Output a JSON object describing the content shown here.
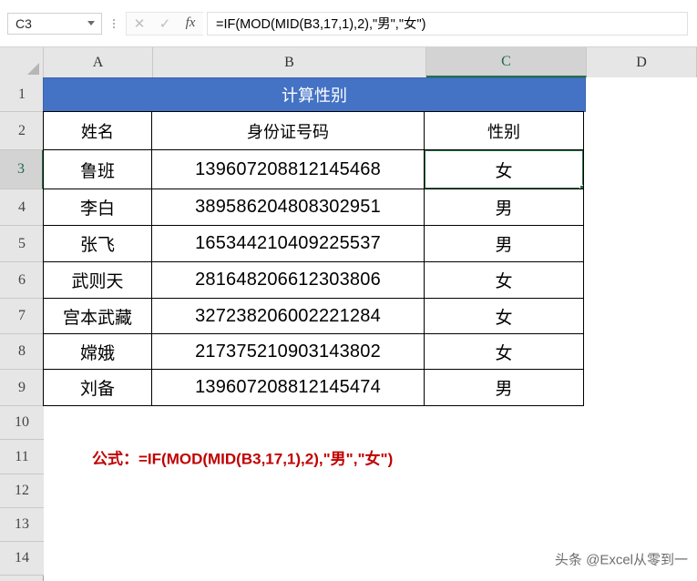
{
  "formula_bar": {
    "name_box_value": "C3",
    "name_box_caret_icon": "chevron-down-icon",
    "cancel_icon": "✕",
    "confirm_icon": "✓",
    "function_icon": "fx",
    "formula_value": "=IF(MOD(MID(B3,17,1),2),\"男\",\"女\")"
  },
  "grid": {
    "columns": [
      "A",
      "B",
      "C",
      "D"
    ],
    "selected_column": "C",
    "selected_row": "3",
    "selected_cell": "C3",
    "row_numbers": [
      "1",
      "2",
      "3",
      "4",
      "5",
      "6",
      "7",
      "8",
      "9",
      "10",
      "11",
      "12",
      "13",
      "14"
    ]
  },
  "sheet": {
    "title": "计算性别",
    "title_bg": "#4472C4",
    "headers": [
      "姓名",
      "身份证号码",
      "性别"
    ],
    "rows": [
      {
        "name": "鲁班",
        "id": "139607208812145468",
        "gender": "女"
      },
      {
        "name": "李白",
        "id": "389586204808302951",
        "gender": "男"
      },
      {
        "name": "张飞",
        "id": "165344210409225537",
        "gender": "男"
      },
      {
        "name": "武则天",
        "id": "281648206612303806",
        "gender": "女"
      },
      {
        "name": "宫本武藏",
        "id": "327238206002221284",
        "gender": "女"
      },
      {
        "name": "嫦娥",
        "id": "217375210903143802",
        "gender": "女"
      },
      {
        "name": "刘备",
        "id": "139607208812145474",
        "gender": "男"
      }
    ],
    "note": "公式：=IF(MOD(MID(B3,17,1),2),\"男\",\"女\")",
    "note_color": "#C00000",
    "watermark": "头条 @Excel从零到一"
  }
}
